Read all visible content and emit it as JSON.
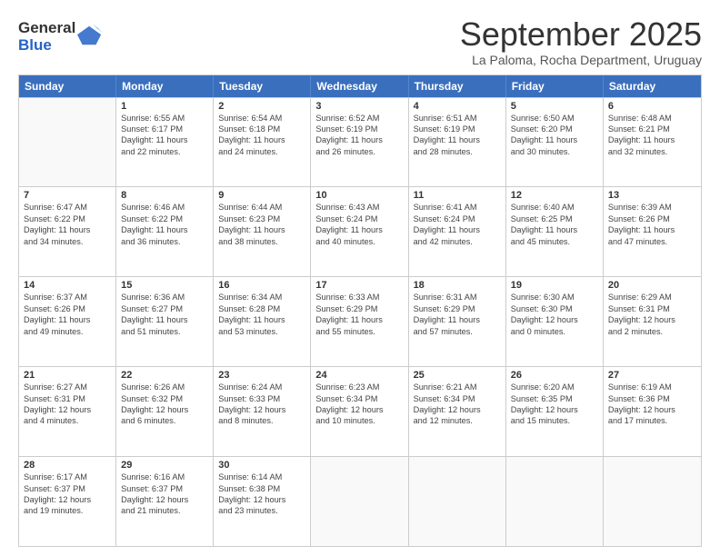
{
  "logo": {
    "general": "General",
    "blue": "Blue"
  },
  "title": "September 2025",
  "location": "La Paloma, Rocha Department, Uruguay",
  "header_days": [
    "Sunday",
    "Monday",
    "Tuesday",
    "Wednesday",
    "Thursday",
    "Friday",
    "Saturday"
  ],
  "weeks": [
    [
      {
        "day": "",
        "lines": []
      },
      {
        "day": "1",
        "lines": [
          "Sunrise: 6:55 AM",
          "Sunset: 6:17 PM",
          "Daylight: 11 hours",
          "and 22 minutes."
        ]
      },
      {
        "day": "2",
        "lines": [
          "Sunrise: 6:54 AM",
          "Sunset: 6:18 PM",
          "Daylight: 11 hours",
          "and 24 minutes."
        ]
      },
      {
        "day": "3",
        "lines": [
          "Sunrise: 6:52 AM",
          "Sunset: 6:19 PM",
          "Daylight: 11 hours",
          "and 26 minutes."
        ]
      },
      {
        "day": "4",
        "lines": [
          "Sunrise: 6:51 AM",
          "Sunset: 6:19 PM",
          "Daylight: 11 hours",
          "and 28 minutes."
        ]
      },
      {
        "day": "5",
        "lines": [
          "Sunrise: 6:50 AM",
          "Sunset: 6:20 PM",
          "Daylight: 11 hours",
          "and 30 minutes."
        ]
      },
      {
        "day": "6",
        "lines": [
          "Sunrise: 6:48 AM",
          "Sunset: 6:21 PM",
          "Daylight: 11 hours",
          "and 32 minutes."
        ]
      }
    ],
    [
      {
        "day": "7",
        "lines": [
          "Sunrise: 6:47 AM",
          "Sunset: 6:22 PM",
          "Daylight: 11 hours",
          "and 34 minutes."
        ]
      },
      {
        "day": "8",
        "lines": [
          "Sunrise: 6:46 AM",
          "Sunset: 6:22 PM",
          "Daylight: 11 hours",
          "and 36 minutes."
        ]
      },
      {
        "day": "9",
        "lines": [
          "Sunrise: 6:44 AM",
          "Sunset: 6:23 PM",
          "Daylight: 11 hours",
          "and 38 minutes."
        ]
      },
      {
        "day": "10",
        "lines": [
          "Sunrise: 6:43 AM",
          "Sunset: 6:24 PM",
          "Daylight: 11 hours",
          "and 40 minutes."
        ]
      },
      {
        "day": "11",
        "lines": [
          "Sunrise: 6:41 AM",
          "Sunset: 6:24 PM",
          "Daylight: 11 hours",
          "and 42 minutes."
        ]
      },
      {
        "day": "12",
        "lines": [
          "Sunrise: 6:40 AM",
          "Sunset: 6:25 PM",
          "Daylight: 11 hours",
          "and 45 minutes."
        ]
      },
      {
        "day": "13",
        "lines": [
          "Sunrise: 6:39 AM",
          "Sunset: 6:26 PM",
          "Daylight: 11 hours",
          "and 47 minutes."
        ]
      }
    ],
    [
      {
        "day": "14",
        "lines": [
          "Sunrise: 6:37 AM",
          "Sunset: 6:26 PM",
          "Daylight: 11 hours",
          "and 49 minutes."
        ]
      },
      {
        "day": "15",
        "lines": [
          "Sunrise: 6:36 AM",
          "Sunset: 6:27 PM",
          "Daylight: 11 hours",
          "and 51 minutes."
        ]
      },
      {
        "day": "16",
        "lines": [
          "Sunrise: 6:34 AM",
          "Sunset: 6:28 PM",
          "Daylight: 11 hours",
          "and 53 minutes."
        ]
      },
      {
        "day": "17",
        "lines": [
          "Sunrise: 6:33 AM",
          "Sunset: 6:29 PM",
          "Daylight: 11 hours",
          "and 55 minutes."
        ]
      },
      {
        "day": "18",
        "lines": [
          "Sunrise: 6:31 AM",
          "Sunset: 6:29 PM",
          "Daylight: 11 hours",
          "and 57 minutes."
        ]
      },
      {
        "day": "19",
        "lines": [
          "Sunrise: 6:30 AM",
          "Sunset: 6:30 PM",
          "Daylight: 12 hours",
          "and 0 minutes."
        ]
      },
      {
        "day": "20",
        "lines": [
          "Sunrise: 6:29 AM",
          "Sunset: 6:31 PM",
          "Daylight: 12 hours",
          "and 2 minutes."
        ]
      }
    ],
    [
      {
        "day": "21",
        "lines": [
          "Sunrise: 6:27 AM",
          "Sunset: 6:31 PM",
          "Daylight: 12 hours",
          "and 4 minutes."
        ]
      },
      {
        "day": "22",
        "lines": [
          "Sunrise: 6:26 AM",
          "Sunset: 6:32 PM",
          "Daylight: 12 hours",
          "and 6 minutes."
        ]
      },
      {
        "day": "23",
        "lines": [
          "Sunrise: 6:24 AM",
          "Sunset: 6:33 PM",
          "Daylight: 12 hours",
          "and 8 minutes."
        ]
      },
      {
        "day": "24",
        "lines": [
          "Sunrise: 6:23 AM",
          "Sunset: 6:34 PM",
          "Daylight: 12 hours",
          "and 10 minutes."
        ]
      },
      {
        "day": "25",
        "lines": [
          "Sunrise: 6:21 AM",
          "Sunset: 6:34 PM",
          "Daylight: 12 hours",
          "and 12 minutes."
        ]
      },
      {
        "day": "26",
        "lines": [
          "Sunrise: 6:20 AM",
          "Sunset: 6:35 PM",
          "Daylight: 12 hours",
          "and 15 minutes."
        ]
      },
      {
        "day": "27",
        "lines": [
          "Sunrise: 6:19 AM",
          "Sunset: 6:36 PM",
          "Daylight: 12 hours",
          "and 17 minutes."
        ]
      }
    ],
    [
      {
        "day": "28",
        "lines": [
          "Sunrise: 6:17 AM",
          "Sunset: 6:37 PM",
          "Daylight: 12 hours",
          "and 19 minutes."
        ]
      },
      {
        "day": "29",
        "lines": [
          "Sunrise: 6:16 AM",
          "Sunset: 6:37 PM",
          "Daylight: 12 hours",
          "and 21 minutes."
        ]
      },
      {
        "day": "30",
        "lines": [
          "Sunrise: 6:14 AM",
          "Sunset: 6:38 PM",
          "Daylight: 12 hours",
          "and 23 minutes."
        ]
      },
      {
        "day": "",
        "lines": []
      },
      {
        "day": "",
        "lines": []
      },
      {
        "day": "",
        "lines": []
      },
      {
        "day": "",
        "lines": []
      }
    ]
  ]
}
